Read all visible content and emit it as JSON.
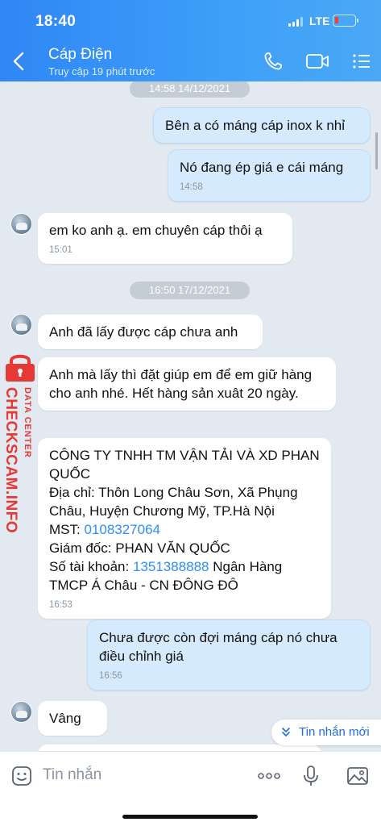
{
  "status_bar": {
    "time": "18:40",
    "network": "LTE"
  },
  "header": {
    "title": "Cáp Điện",
    "subtitle": "Truy cập 19 phút trước"
  },
  "messages": {
    "date1": "14:58 14/12/2021",
    "m1": {
      "text": "Bên a có máng cáp inox k nhỉ"
    },
    "m2": {
      "text": "Nó đang ép giá e cái máng",
      "time": "14:58"
    },
    "m3": {
      "text": "em ko anh ạ. em chuyên cáp thôi ạ",
      "time": "15:01"
    },
    "date2": "16:50 17/12/2021",
    "m4": {
      "text": "Anh đã lấy được cáp chưa anh"
    },
    "m5": {
      "text": "Anh mà lấy thì đặt giúp em để em giữ hàng cho anh nhé. Hết hàng sản xuât 20 ngày."
    },
    "m6": {
      "line1": "CÔNG TY TNHH TM VẬN TẢI VÀ XD PHAN QUỐC",
      "address": "Địa chỉ: Thôn Long Châu Sơn, Xã Phụng Châu, Huyện Chương Mỹ, TP.Hà Nội",
      "mst_label": "MST: ",
      "mst_value": "0108327064",
      "director": "Giám đốc: PHAN VĂN QUỐC",
      "account_label": "Số tài khoản: ",
      "account_number": "1351388888",
      "bank": " Ngân Hàng TMCP Á Châu - CN ĐÔNG ĐÔ",
      "time": "16:53"
    },
    "m7": {
      "text": "Chưa được còn đợi máng cáp nó chưa điều chỉnh giá",
      "time": "16:56"
    },
    "m8": {
      "text": "Vâng"
    }
  },
  "new_messages_label": "Tin nhắn mới",
  "watermark": {
    "brand": "CHECKSCAM.INFO",
    "tag": "DATA CENTER"
  },
  "composer": {
    "placeholder": "Tin nhắn"
  },
  "colors": {
    "header": "#3a95f7",
    "outgoing_bubble": "#d5ebfd",
    "link": "#2f8ef3",
    "watermark": "#e53935"
  },
  "icons": [
    "back-icon",
    "phone-icon",
    "video-icon",
    "menu-icon",
    "sticker-icon",
    "more-icon",
    "mic-icon",
    "image-icon",
    "chevron-down-icon",
    "lock-icon"
  ]
}
